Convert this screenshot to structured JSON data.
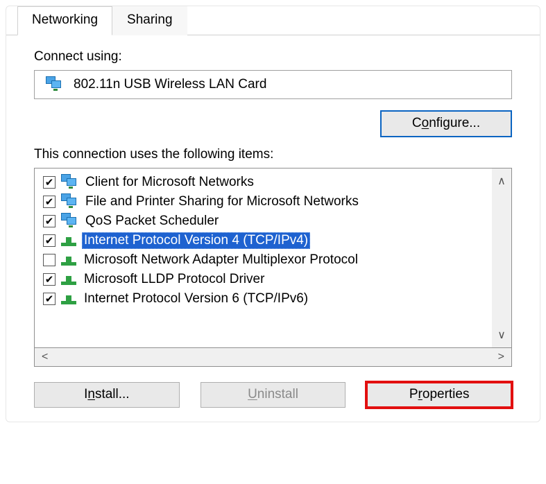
{
  "tabs": {
    "networking": "Networking",
    "sharing": "Sharing"
  },
  "connect_using_label": "Connect using:",
  "adapter_name": "802.11n USB Wireless LAN Card",
  "configure_btn_pre": "C",
  "configure_btn_ul": "o",
  "configure_btn_post": "nfigure...",
  "items_label_pre": "This c",
  "items_label_ul": "o",
  "items_label_post": "nnection uses the following items:",
  "items": [
    {
      "label": "Client for Microsoft Networks",
      "checked": true,
      "icon": "monitors",
      "selected": false
    },
    {
      "label": "File and Printer Sharing for Microsoft Networks",
      "checked": true,
      "icon": "monitors",
      "selected": false
    },
    {
      "label": "QoS Packet Scheduler",
      "checked": true,
      "icon": "monitors",
      "selected": false
    },
    {
      "label": "Internet Protocol Version 4 (TCP/IPv4)",
      "checked": true,
      "icon": "plug",
      "selected": true
    },
    {
      "label": "Microsoft Network Adapter Multiplexor Protocol",
      "checked": false,
      "icon": "plug",
      "selected": false
    },
    {
      "label": "Microsoft LLDP Protocol Driver",
      "checked": true,
      "icon": "plug",
      "selected": false
    },
    {
      "label": "Internet Protocol Version 6 (TCP/IPv6)",
      "checked": true,
      "icon": "plug",
      "selected": false
    }
  ],
  "install_btn_pre": "I",
  "install_btn_ul": "n",
  "install_btn_post": "stall...",
  "uninstall_btn_ul": "U",
  "uninstall_btn_post": "ninstall",
  "properties_btn_pre": "P",
  "properties_btn_ul": "r",
  "properties_btn_post": "operties"
}
